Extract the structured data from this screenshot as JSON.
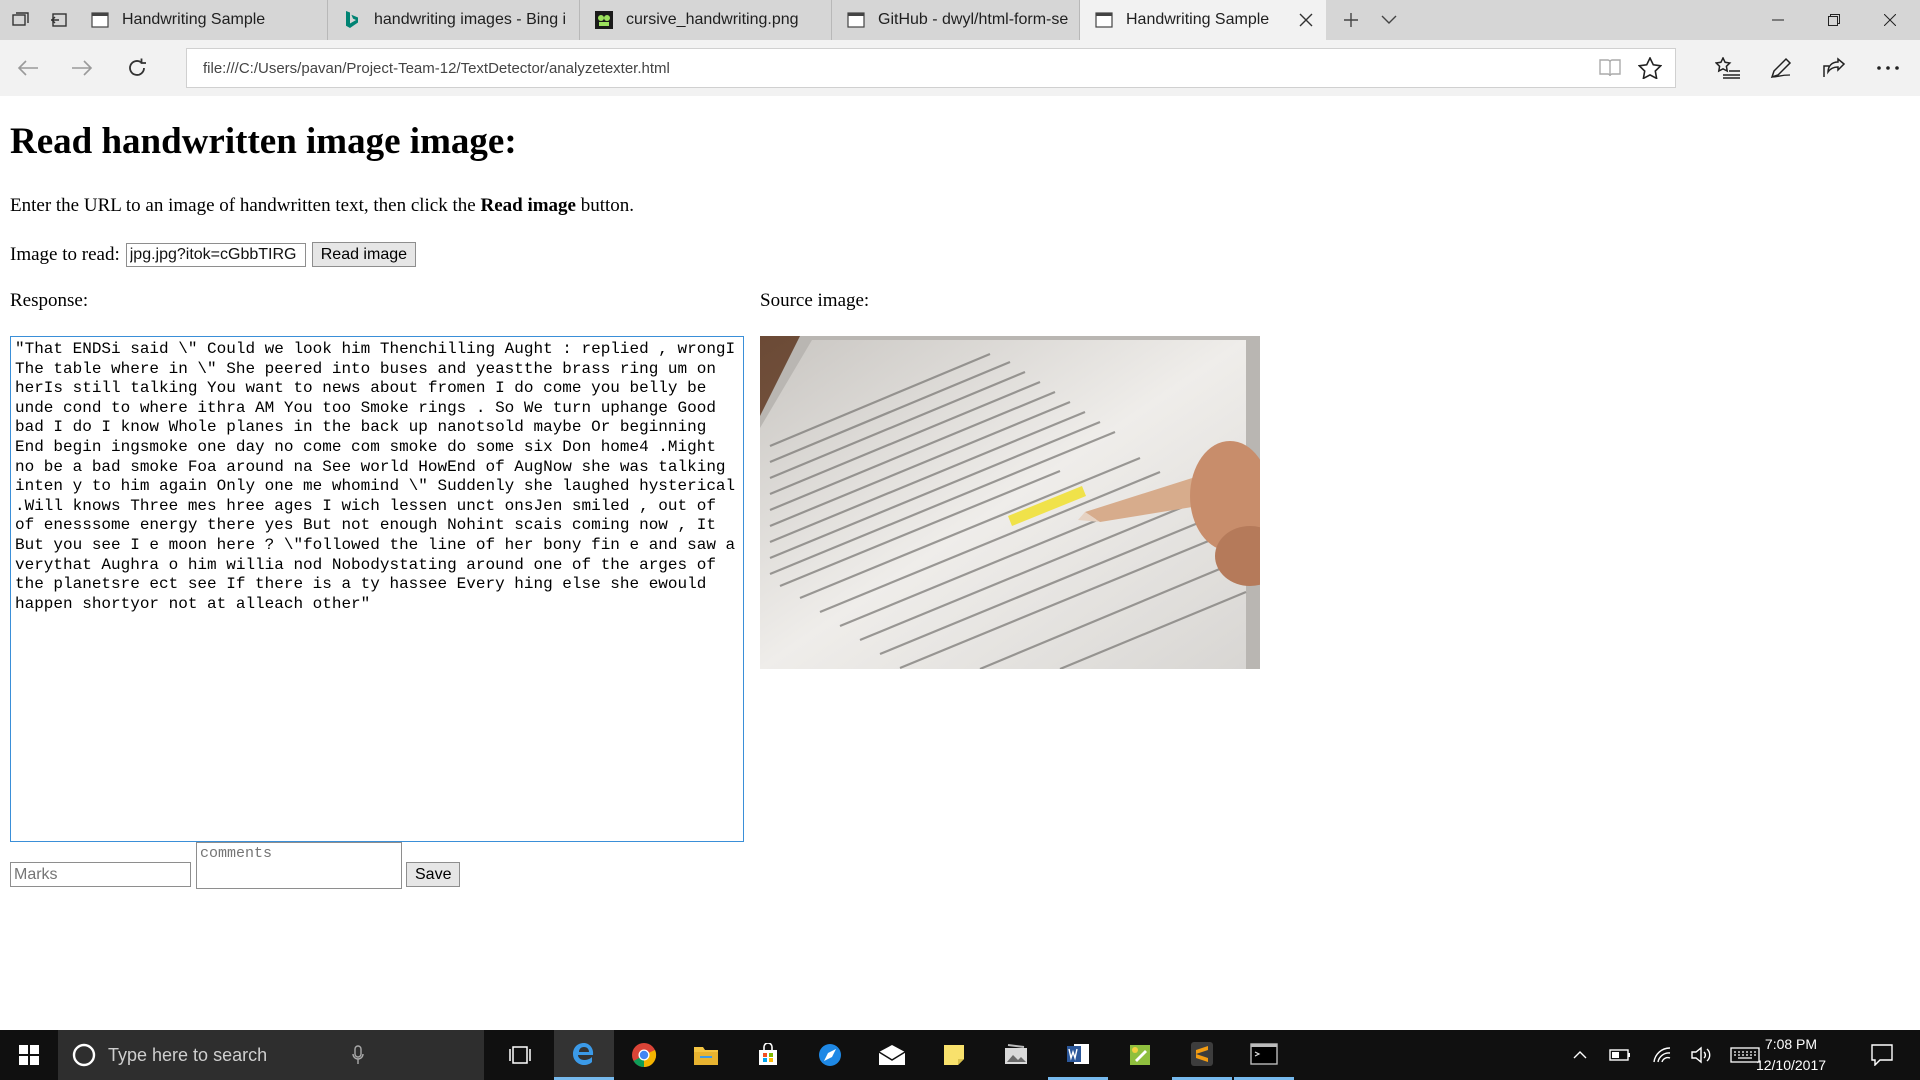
{
  "tabs": [
    {
      "title": "Handwriting Sample",
      "icon": "page-icon",
      "active": false
    },
    {
      "title": "handwriting images - Bing i",
      "icon": "bing-icon",
      "active": false
    },
    {
      "title": "cursive_handwriting.png",
      "icon": "image-icon",
      "active": false
    },
    {
      "title": "GitHub - dwyl/html-form-se",
      "icon": "page-icon",
      "active": false
    },
    {
      "title": "Handwriting Sample",
      "icon": "page-icon",
      "active": true
    }
  ],
  "address": {
    "url": "file:///C:/Users/pavan/Project-Team-12/TextDetector/analyzetexter.html"
  },
  "page": {
    "heading": "Read handwritten image image:",
    "intro_before": "Enter the URL to an image of handwritten text, then click the ",
    "intro_bold": "Read image",
    "intro_after": " button.",
    "image_label": "Image to read:",
    "image_url_value": "jpg.jpg?itok=cGbbTIRG",
    "read_button": "Read image",
    "response_label": "Response:",
    "source_label": "Source image:",
    "response_text": "\"That ENDSi said \\\" Could we look him Thenchilling Aught : replied , wrongI The table where in \\\" She peered into buses and yeastthe brass ring um on herIs still talking You want to news about fromen I do come you belly be unde cond to where ithra AM You too Smoke rings . So We turn uphange Good bad I do I know Whole planes in the back up nanotsold maybe Or beginning End begin ingsmoke one day no come com smoke do some six Don home4 .Might no be a bad smoke Foa around na See world HowEnd of AugNow she was talking inten y to him again Only one me whomind \\\" Suddenly she laughed hysterical .Will knows Three mes hree ages I wich lessen unct onsJen smiled , out of of enesssome energy there yes But not enough Nohint scais coming now , It But you see I e moon here ? \\\"followed the line of her bony fin e and saw a verythat Aughra o him willia nod Nobodystating around one of the arges of the planetsre ect see If there is a ty hassee Every hing else she ewould happen shortyor not at alleach other\"",
    "marks_placeholder": "Marks",
    "comments_placeholder": "comments",
    "save_button": "Save"
  },
  "taskbar": {
    "search_placeholder": "Type here to search",
    "time": "7:08 PM",
    "date": "12/10/2017"
  },
  "colors": {
    "tabbar_bg": "#d6d6d6",
    "active_tab_bg": "#f2f2f2",
    "taskbar_bg": "#101010",
    "focus_border": "#3a8fd8"
  }
}
